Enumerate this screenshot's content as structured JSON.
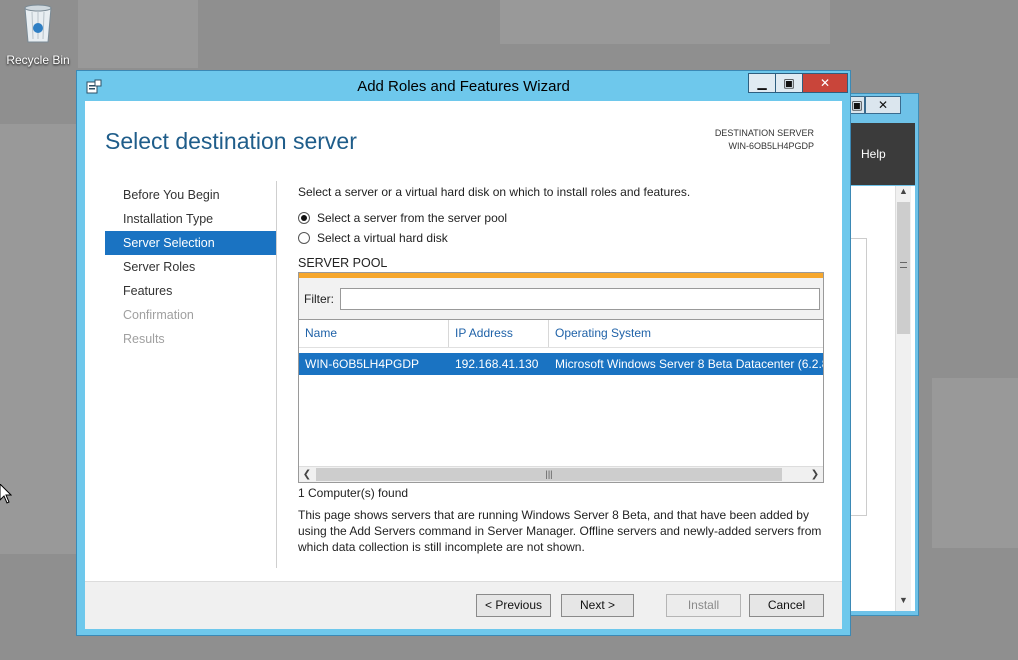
{
  "desktop": {
    "recycle_bin_label": "Recycle Bin"
  },
  "bg_window": {
    "restore_icon": "restore-icon",
    "close_icon": "close-icon",
    "help_label": "Help"
  },
  "wizard": {
    "title": "Add Roles and Features Wizard",
    "page_title": "Select destination server",
    "destination": {
      "label": "DESTINATION SERVER",
      "server": "WIN-6OB5LH4PGDP"
    },
    "nav": [
      {
        "label": "Before You Begin",
        "state": "normal"
      },
      {
        "label": "Installation Type",
        "state": "normal"
      },
      {
        "label": "Server Selection",
        "state": "active"
      },
      {
        "label": "Server Roles",
        "state": "normal"
      },
      {
        "label": "Features",
        "state": "normal"
      },
      {
        "label": "Confirmation",
        "state": "disabled"
      },
      {
        "label": "Results",
        "state": "disabled"
      }
    ],
    "intro": "Select a server or a virtual hard disk on which to install roles and features.",
    "options": [
      {
        "label": "Select a server from the server pool",
        "selected": true
      },
      {
        "label": "Select a virtual hard disk",
        "selected": false
      }
    ],
    "pool": {
      "heading": "SERVER POOL",
      "filter_label": "Filter:",
      "filter_value": "",
      "columns": [
        "Name",
        "IP Address",
        "Operating System"
      ],
      "rows": [
        {
          "name": "WIN-6OB5LH4PGDP",
          "ip": "192.168.41.130",
          "os": "Microsoft Windows Server 8 Beta Datacenter (6.2.8..."
        }
      ]
    },
    "found": "1 Computer(s) found",
    "description": "This page shows servers that are running Windows Server 8 Beta, and that have been added by using the Add Servers command in Server Manager. Offline servers and newly-added servers from which data collection is still incomplete are not shown.",
    "buttons": {
      "previous": "< Previous",
      "next": "Next >",
      "install": "Install",
      "cancel": "Cancel"
    }
  },
  "colors": {
    "accent": "#1a73c2",
    "window_frame": "#6ec8ec",
    "title_text": "#1f5d8a",
    "pool_bar": "#f6a72d"
  }
}
